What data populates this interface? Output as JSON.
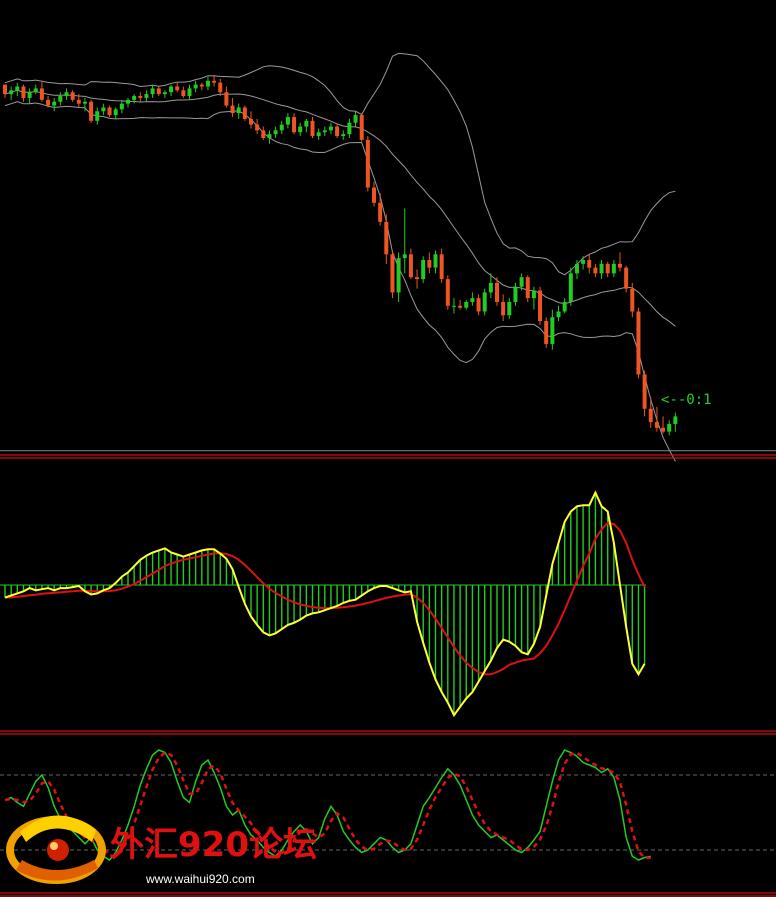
{
  "chart_data": [
    {
      "type": "candlestick",
      "panel": "price",
      "indicator": "bollinger-bands",
      "annotation": "<--0:1",
      "grid": false,
      "colors": {
        "up": "#22cc22",
        "down": "#ee5522",
        "bands": "#9a9a9a",
        "hline": "#888888"
      },
      "candles": [
        [
          104,
          102,
          97,
          99
        ],
        [
          99,
          103,
          96,
          101
        ],
        [
          101,
          105,
          98,
          103
        ],
        [
          103,
          104,
          95,
          97
        ],
        [
          97,
          102,
          94,
          100
        ],
        [
          100,
          104,
          99,
          102
        ],
        [
          102,
          106,
          95,
          96
        ],
        [
          96,
          98,
          92,
          93
        ],
        [
          93,
          97,
          90,
          95
        ],
        [
          95,
          100,
          93,
          98
        ],
        [
          98,
          102,
          96,
          100
        ],
        [
          100,
          101,
          95,
          96
        ],
        [
          96,
          99,
          92,
          94
        ],
        [
          94,
          97,
          90,
          95
        ],
        [
          95,
          96,
          84,
          85
        ],
        [
          85,
          92,
          83,
          90
        ],
        [
          90,
          94,
          88,
          92
        ],
        [
          92,
          93,
          87,
          88
        ],
        [
          88,
          92,
          86,
          91
        ],
        [
          91,
          96,
          89,
          94
        ],
        [
          94,
          97,
          92,
          96
        ],
        [
          96,
          99,
          94,
          98
        ],
        [
          98,
          100,
          95,
          97
        ],
        [
          97,
          101,
          95,
          99
        ],
        [
          99,
          104,
          97,
          102
        ],
        [
          102,
          103,
          98,
          99
        ],
        [
          99,
          101,
          97,
          100
        ],
        [
          100,
          104,
          98,
          103
        ],
        [
          103,
          105,
          100,
          101
        ],
        [
          101,
          103,
          97,
          98
        ],
        [
          98,
          104,
          96,
          102
        ],
        [
          102,
          106,
          100,
          104
        ],
        [
          104,
          105,
          101,
          103
        ],
        [
          103,
          108,
          101,
          106
        ],
        [
          106,
          109,
          103,
          105
        ],
        [
          105,
          107,
          98,
          100
        ],
        [
          100,
          103,
          92,
          93
        ],
        [
          93,
          97,
          87,
          89
        ],
        [
          89,
          94,
          86,
          92
        ],
        [
          92,
          93,
          85,
          86
        ],
        [
          86,
          90,
          81,
          83
        ],
        [
          83,
          86,
          78,
          80
        ],
        [
          80,
          82,
          75,
          76
        ],
        [
          76,
          80,
          73,
          78
        ],
        [
          78,
          82,
          76,
          80
        ],
        [
          80,
          85,
          78,
          83
        ],
        [
          83,
          89,
          81,
          87
        ],
        [
          87,
          89,
          78,
          79
        ],
        [
          79,
          84,
          77,
          82
        ],
        [
          82,
          86,
          79,
          85
        ],
        [
          85,
          87,
          76,
          77
        ],
        [
          77,
          81,
          75,
          79
        ],
        [
          79,
          82,
          77,
          80
        ],
        [
          80,
          84,
          78,
          82
        ],
        [
          82,
          83,
          76,
          77
        ],
        [
          77,
          80,
          75,
          78
        ],
        [
          78,
          86,
          76,
          84
        ],
        [
          84,
          90,
          82,
          88
        ],
        [
          88,
          89,
          74,
          75
        ],
        [
          75,
          77,
          48,
          50
        ],
        [
          50,
          53,
          40,
          42
        ],
        [
          42,
          47,
          30,
          32
        ],
        [
          32,
          36,
          10,
          15
        ],
        [
          15,
          17,
          -8,
          -5
        ],
        [
          -5,
          16,
          -10,
          13
        ],
        [
          13,
          39,
          5,
          15
        ],
        [
          15,
          18,
          2,
          3
        ],
        [
          3,
          7,
          -3,
          2
        ],
        [
          2,
          14,
          0,
          12
        ],
        [
          12,
          16,
          5,
          8
        ],
        [
          8,
          17,
          5,
          15
        ],
        [
          15,
          18,
          0,
          2
        ],
        [
          2,
          4,
          -14,
          -12
        ],
        [
          -12,
          -8,
          -16,
          -12
        ],
        [
          -12,
          -9,
          -14,
          -13
        ],
        [
          -13,
          -9,
          -14,
          -10
        ],
        [
          -10,
          -5,
          -12,
          -8
        ],
        [
          -8,
          -6,
          -17,
          -15
        ],
        [
          -15,
          -3,
          -17,
          -5
        ],
        [
          -5,
          5,
          -8,
          0
        ],
        [
          0,
          3,
          -12,
          -10
        ],
        [
          -10,
          -6,
          -20,
          -17
        ],
        [
          -17,
          -8,
          -19,
          -10
        ],
        [
          -10,
          0,
          -12,
          -2
        ],
        [
          -2,
          5,
          -4,
          3
        ],
        [
          3,
          4,
          -10,
          -8
        ],
        [
          -8,
          -2,
          -14,
          -4
        ],
        [
          -4,
          -2,
          -22,
          -20
        ],
        [
          -20,
          -18,
          -34,
          -32
        ],
        [
          -32,
          -14,
          -35,
          -18
        ],
        [
          -18,
          -12,
          -20,
          -15
        ],
        [
          -15,
          -8,
          -16,
          -10
        ],
        [
          -10,
          8,
          -12,
          5
        ],
        [
          5,
          12,
          2,
          10
        ],
        [
          10,
          14,
          7,
          12
        ],
        [
          12,
          15,
          5,
          8
        ],
        [
          8,
          10,
          3,
          5
        ],
        [
          5,
          12,
          2,
          10
        ],
        [
          10,
          11,
          3,
          5
        ],
        [
          5,
          12,
          3,
          10
        ],
        [
          10,
          16,
          6,
          8
        ],
        [
          8,
          9,
          -5,
          -3
        ],
        [
          -3,
          0,
          -18,
          -15
        ],
        [
          -15,
          -13,
          -50,
          -48
        ],
        [
          -48,
          -46,
          -70,
          -66
        ],
        [
          -66,
          -60,
          -76,
          -73
        ],
        [
          -73,
          -65,
          -78,
          -76
        ],
        [
          -76,
          -70,
          -79,
          -78
        ],
        [
          -78,
          -72,
          -80,
          -74
        ],
        [
          -74,
          -68,
          -78,
          -70
        ]
      ]
    },
    {
      "type": "bar+line",
      "panel": "macd",
      "colors": {
        "histogram": "#22cc22",
        "main": "#ffff33",
        "signal": "#dd1111",
        "zero": "#22cc22"
      },
      "histogram": [
        -12,
        -10,
        -8,
        -6,
        -3,
        -5,
        -4,
        -3,
        -5,
        -3,
        -3,
        -2,
        -1,
        -6,
        -9,
        -8,
        -5,
        -3,
        2,
        8,
        12,
        18,
        24,
        28,
        31,
        33,
        35,
        31,
        29,
        27,
        29,
        31,
        33,
        34,
        34,
        30,
        25,
        15,
        -2,
        -18,
        -30,
        -38,
        -45,
        -48,
        -46,
        -42,
        -38,
        -36,
        -33,
        -29,
        -27,
        -26,
        -24,
        -22,
        -20,
        -17,
        -15,
        -14,
        -10,
        -6,
        -3,
        -1,
        -1,
        -3,
        -5,
        -7,
        -6,
        -35,
        -55,
        -74,
        -90,
        -102,
        -112,
        -124,
        -116,
        -108,
        -102,
        -92,
        -82,
        -72,
        -60,
        -52,
        -54,
        -58,
        -64,
        -66,
        -56,
        -40,
        -10,
        20,
        40,
        60,
        70,
        75,
        76,
        76,
        88,
        75,
        70,
        40,
        0,
        -40,
        -75,
        -85,
        -75
      ],
      "main": [
        -12,
        -10,
        -8,
        -6,
        -3,
        -5,
        -4,
        -3,
        -5,
        -3,
        -3,
        -2,
        -1,
        -6,
        -9,
        -8,
        -5,
        -3,
        2,
        8,
        12,
        18,
        24,
        28,
        31,
        33,
        35,
        31,
        29,
        27,
        29,
        31,
        33,
        34,
        34,
        30,
        25,
        15,
        -2,
        -18,
        -30,
        -38,
        -45,
        -48,
        -46,
        -42,
        -38,
        -36,
        -33,
        -29,
        -27,
        -26,
        -24,
        -22,
        -20,
        -17,
        -15,
        -14,
        -10,
        -6,
        -3,
        -1,
        -1,
        -3,
        -5,
        -7,
        -6,
        -35,
        -55,
        -74,
        -90,
        -102,
        -112,
        -124,
        -116,
        -108,
        -102,
        -92,
        -82,
        -72,
        -60,
        -52,
        -54,
        -58,
        -64,
        -66,
        -56,
        -40,
        -10,
        20,
        40,
        60,
        70,
        75,
        76,
        76,
        88,
        75,
        70,
        40,
        0,
        -40,
        -75,
        -85,
        -75
      ],
      "signal": [
        -12,
        -11.8,
        -11.2,
        -10.6,
        -9.8,
        -9.2,
        -8.4,
        -7.8,
        -7.4,
        -7,
        -6.5,
        -6,
        -5.4,
        -5.5,
        -5.8,
        -6,
        -6,
        -5.8,
        -5,
        -3.5,
        -1.5,
        1,
        4,
        7.5,
        11,
        14.5,
        18,
        20.5,
        22.5,
        24,
        25.2,
        26.5,
        27.8,
        29,
        30,
        30.2,
        29.5,
        27.5,
        24,
        19,
        13.5,
        7.5,
        1.5,
        -3.5,
        -7.5,
        -11,
        -14,
        -16.5,
        -18.5,
        -20,
        -21,
        -21.7,
        -22,
        -22,
        -21.7,
        -21.2,
        -20.5,
        -19.6,
        -18.5,
        -17,
        -15.5,
        -13.8,
        -12.2,
        -11,
        -10,
        -9.3,
        -8.7,
        -12,
        -17,
        -24,
        -32,
        -41,
        -50,
        -59,
        -67,
        -74,
        -79,
        -83,
        -85,
        -85,
        -83,
        -80,
        -76,
        -74,
        -72,
        -71,
        -70,
        -65,
        -58,
        -48,
        -37,
        -24,
        -10,
        4,
        18,
        30,
        44,
        53,
        59,
        58,
        52,
        40,
        24,
        10,
        -2
      ]
    },
    {
      "type": "line",
      "panel": "stochastic",
      "colors": {
        "main": "#22cc22",
        "signal": "#dd1111",
        "levels": "#666666"
      },
      "levels": [
        80,
        20
      ],
      "main": [
        60,
        62,
        58,
        55,
        65,
        75,
        80,
        70,
        55,
        45,
        40,
        35,
        30,
        25,
        30,
        20,
        15,
        12,
        18,
        28,
        40,
        55,
        72,
        85,
        96,
        100,
        98,
        90,
        75,
        62,
        58,
        75,
        88,
        92,
        82,
        70,
        55,
        48,
        52,
        40,
        32,
        28,
        22,
        18,
        15,
        20,
        28,
        35,
        40,
        35,
        25,
        30,
        45,
        55,
        48,
        35,
        28,
        22,
        18,
        20,
        25,
        30,
        28,
        22,
        18,
        20,
        25,
        40,
        55,
        62,
        70,
        78,
        85,
        80,
        72,
        60,
        48,
        40,
        35,
        30,
        32,
        28,
        24,
        20,
        18,
        22,
        28,
        35,
        55,
        75,
        92,
        100,
        98,
        95,
        90,
        88,
        86,
        82,
        85,
        78,
        60,
        30,
        15,
        12,
        14,
        15
      ]
    },
    {
      "type": "logo",
      "text": "外汇920论坛",
      "url": "www.waihui920.com"
    }
  ]
}
